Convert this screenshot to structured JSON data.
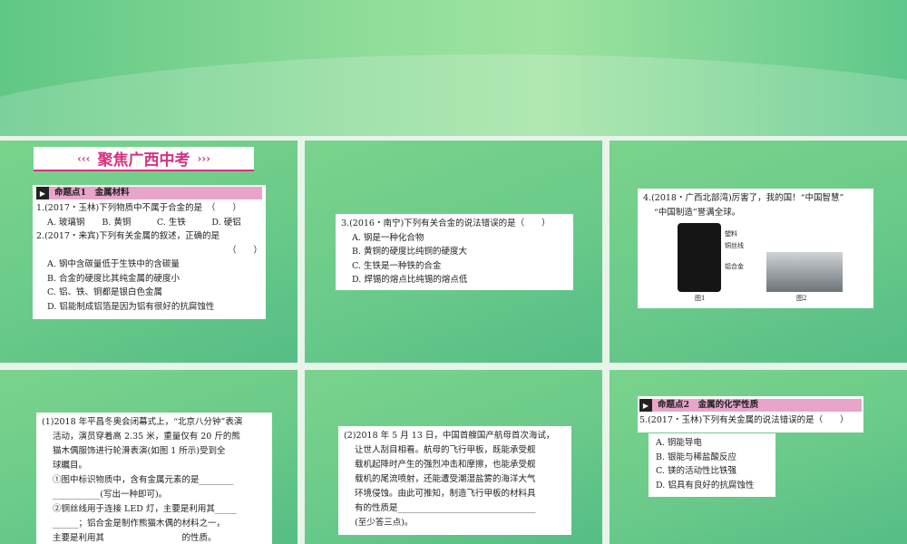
{
  "slide1": {
    "title": "聚焦广西中考",
    "title_left": "‹‹‹",
    "title_right": "›››",
    "header": "命题点1　金属材料",
    "lines": [
      "1.(2017・玉林)下列物质中不属于合金的是　（　　）",
      "A. 玻璃钢　　B. 黄铜　　　C. 生铁　　　D. 硬铝",
      "2.(2017・来宾)下列有关金属的叙述，正确的是",
      "（　　）",
      "A. 钢中含碳量低于生铁中的含碳量",
      "B. 合金的硬度比其纯金属的硬度小",
      "C. 铝、铁、铜都是银白色金属",
      "D. 铝能制成铝箔是因为铝有很好的抗腐蚀性"
    ]
  },
  "slide2": {
    "lines": [
      "3.(2016・南宁)下列有关合金的说法错误的是（　　）",
      "A. 钢是一种化合物",
      "B. 黄铜的硬度比纯铜的硬度大",
      "C. 生铁是一种铁的合金",
      "D. 焊锡的熔点比纯锡的熔点低"
    ]
  },
  "slide3": {
    "lines": [
      "4.(2018・广西北部湾)厉害了，我的国！“中国智慧”",
      "“中国制造”誉满全球。"
    ],
    "labels": [
      "塑料",
      "铜丝线",
      "铝合金"
    ],
    "fig1": "图1",
    "fig2": "图2"
  },
  "slide4": {
    "lines": [
      "(1)2018 年平昌冬奥会闭幕式上，“北京八分钟”表演",
      "活动，演员穿着高 2.35 米，重量仅有 20 斤的熊",
      "猫木偶服饰进行轮滑表演(如图 1 所示)受到全",
      "球瞩目。",
      "①图中标识物质中，含有金属元素的是________",
      "___________(写出一种即可)。",
      "②铜丝线用于连接 LED 灯，主要是利用其_____",
      "______；铝合金是制作熊猫木偶的材料之一，",
      "主要是利用其　　　　　　　　　的性质。"
    ]
  },
  "slide5": {
    "lines": [
      "(2)2018 年 5 月 13 日，中国首艘国产航母首次海试，",
      "让世人刮目相看。航母的飞行甲板，既能承受舰",
      "载机起降时产生的强烈冲击和摩擦，也能承受舰",
      "载机的尾流喷射，还能遭受潮湿盐雾的海洋大气",
      "环境侵蚀。由此可推知，制造飞行甲板的材料具",
      "有的性质是________________________________",
      "(至少答三点)。"
    ]
  },
  "slide6": {
    "header": "命题点2　金属的化学性质",
    "question": "5.(2017・玉林)下列有关金属的说法错误的是（　　）",
    "options": [
      "A. 铜能导电",
      "B. 银能与稀盐酸反应",
      "C. 镁的活动性比铁强",
      "D. 铝具有良好的抗腐蚀性"
    ]
  }
}
